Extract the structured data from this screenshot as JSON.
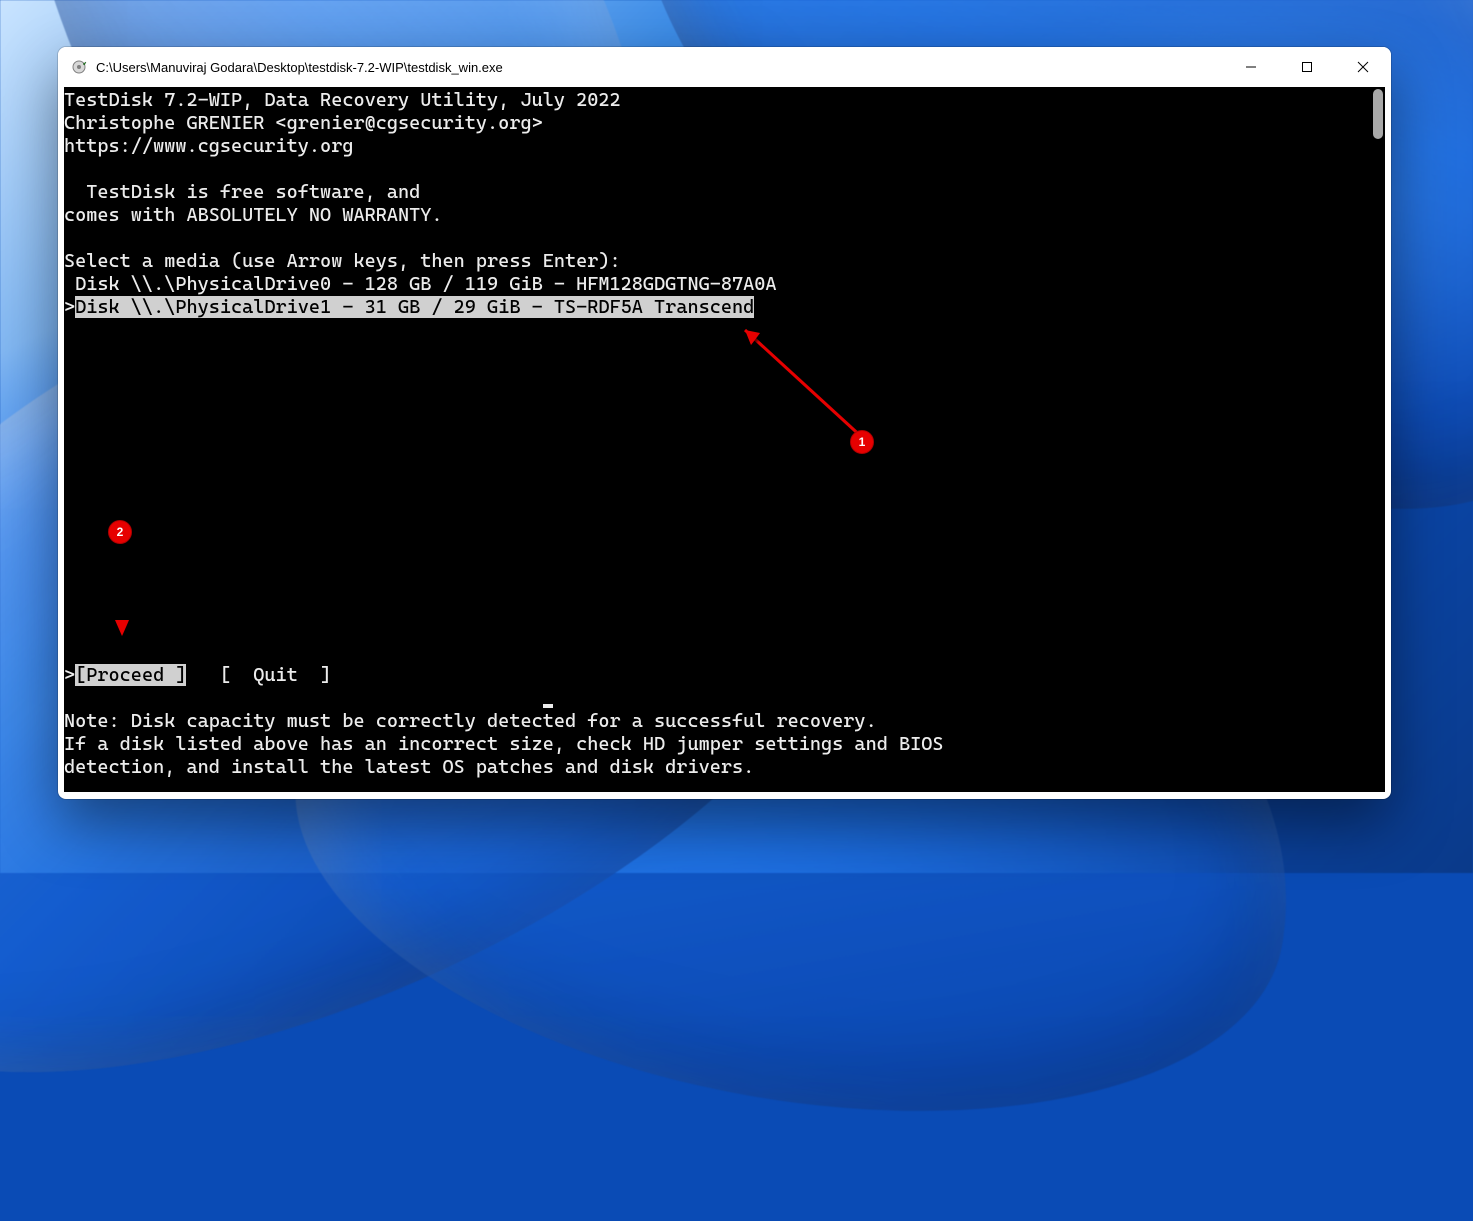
{
  "window": {
    "title": "C:\\Users\\Manuviraj Godara\\Desktop\\testdisk-7.2-WIP\\testdisk_win.exe"
  },
  "terminal": {
    "line1": "TestDisk 7.2-WIP, Data Recovery Utility, July 2022",
    "line2": "Christophe GRENIER <grenier@cgsecurity.org>",
    "line3": "https://www.cgsecurity.org",
    "line5": "  TestDisk is free software, and",
    "line6": "comes with ABSOLUTELY NO WARRANTY.",
    "line8": "Select a media (use Arrow keys, then press Enter):",
    "disk0": " Disk \\\\.\\PhysicalDrive0 - 128 GB / 119 GiB - HFM128GDGTNG-87A0A",
    "disk1_pre": ">",
    "disk1_sel": "Disk \\\\.\\PhysicalDrive1 - 31 GB / 29 GiB - TS-RDF5A Transcend",
    "menu_pre": ">",
    "menu_proceed": "[Proceed ]",
    "menu_gap": "   ",
    "menu_quit": "[  Quit  ]",
    "note1": "Note: Disk capacity must be correctly detected for a successful recovery.",
    "note2": "If a disk listed above has an incorrect size, check HD jumper settings and BIOS",
    "note3": "detection, and install the latest OS patches and disk drivers."
  },
  "annotations": {
    "badge1": "1",
    "badge2": "2"
  }
}
